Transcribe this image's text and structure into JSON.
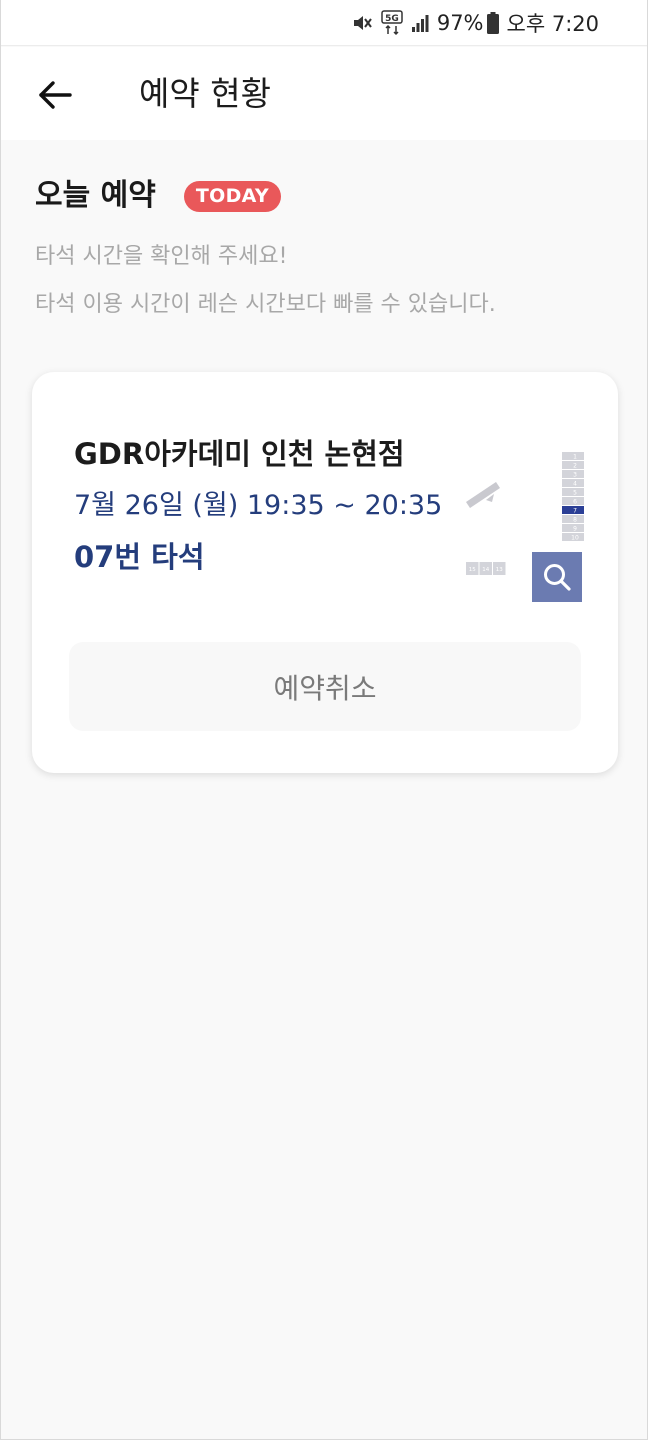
{
  "status_bar": {
    "battery": "97%",
    "time": "오후 7:20",
    "network": "5G",
    "icons": [
      "mute-icon",
      "network-5g-icon",
      "signal-icon",
      "battery-icon"
    ]
  },
  "header": {
    "title": "예약 현황",
    "back_icon": "arrow-left-icon"
  },
  "section": {
    "title": "오늘 예약",
    "badge": "TODAY"
  },
  "notices": [
    "타석 시간을 확인해 주세요!",
    "타석 이용 시간이 레슨 시간보다 빠를 수 있습니다."
  ],
  "reservation": {
    "venue": "GDR아카데미 인천 논현점",
    "datetime": "7월 26일 (월) 19:35 ~ 20:35",
    "seat": "07번 타석",
    "cancel_label": "예약취소",
    "seat_map": {
      "column_seats": [
        "1",
        "2",
        "3",
        "4",
        "5",
        "6",
        "7",
        "8",
        "9",
        "10"
      ],
      "selected_seat": "7",
      "bottom_seats": [
        "15",
        "14",
        "13"
      ]
    }
  },
  "colors": {
    "accent": "#243d7c",
    "badge": "#e9585a",
    "selected_seat": "#2b3f96",
    "search_button": "#6b7bb1"
  }
}
